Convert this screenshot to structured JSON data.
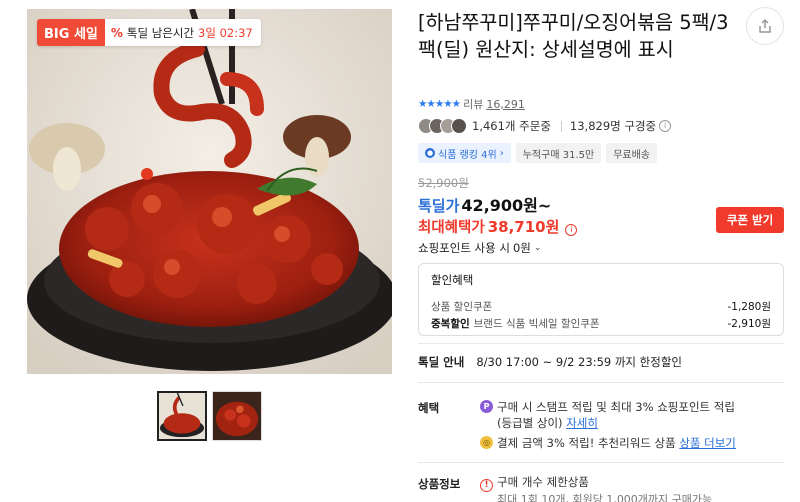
{
  "gallery": {
    "badge": {
      "big": "BIG 세일",
      "pct_icon": "%",
      "timer_label": "톡딜 남은시간",
      "timer_value": "3일 02:37"
    },
    "main_image_alt": "spicy-octopus-stir-fry",
    "thumbnails": [
      {
        "name": "thumb-1",
        "active": true
      },
      {
        "name": "thumb-2",
        "active": false
      }
    ]
  },
  "product": {
    "title": "[하남쭈꾸미]쭈꾸미/오징어볶음 5팩/3팩(딜) 원산지: 상세설명에 표시",
    "share_icon": "share-icon",
    "rating_stars": "★★★★★",
    "review_label": "리뷰",
    "review_count": "16,291",
    "orders": "1,461개 주문중",
    "viewers": "13,829명 구경중",
    "tags": [
      "식품 랭킹 4위",
      "누적구매 31.5만",
      "무료배송"
    ],
    "tag_rank_arrow": "›"
  },
  "pricing": {
    "original_price": "52,900원",
    "deal_label": "톡딜가",
    "deal_price": "42,900원~",
    "max_label": "최대혜택가",
    "max_price": "38,710원",
    "coupon_button": "쿠폰 받기",
    "points_label": "쇼핑포인트 사용 시",
    "points_value": "0원",
    "info_mark": "i",
    "chevron": "⌄"
  },
  "discount": {
    "head": "할인혜택",
    "lines": [
      {
        "prefix": "",
        "label": "상품 할인쿠폰",
        "amount": "-1,280원"
      },
      {
        "prefix": "중복할인",
        "label": "브랜드 식품 빅세일 할인쿠폰",
        "amount": "-2,910원"
      }
    ]
  },
  "special": {
    "label": "톡딜 안내",
    "text": "8/30 17:00 ~ 9/2 23:59 까지 한정할인"
  },
  "benefits": {
    "label": "혜택",
    "items": [
      {
        "icon": "P",
        "text": "구매 시 스탬프 적립 및 최대 3% 쇼핑포인트 적립",
        "text2": "(등급별 상이)",
        "link": "자세히"
      },
      {
        "icon": "◎",
        "text": "결제 금액 3% 적립! 추천리워드 상품",
        "link": "상품 더보기"
      }
    ]
  },
  "product_info": {
    "label": "상품정보",
    "warning_icon": "!",
    "item": "구매 개수 제한상품",
    "sub": "최대 1회 10개, 회원당 1,000개까지 구매가능"
  },
  "colors": {
    "accent_red": "#ef3a2c",
    "accent_blue": "#2b6fd8"
  }
}
